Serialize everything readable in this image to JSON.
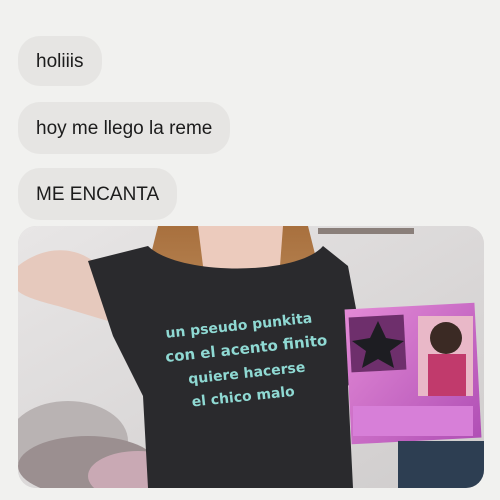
{
  "messages": [
    {
      "text": "holiiis"
    },
    {
      "text": "hoy me llego la reme"
    },
    {
      "text": "ME ENCANTA"
    }
  ],
  "photo": {
    "shirt_lines": [
      "un pseudo punkita",
      "con el acento finito",
      "quiere hacerse",
      "el chico malo"
    ]
  }
}
